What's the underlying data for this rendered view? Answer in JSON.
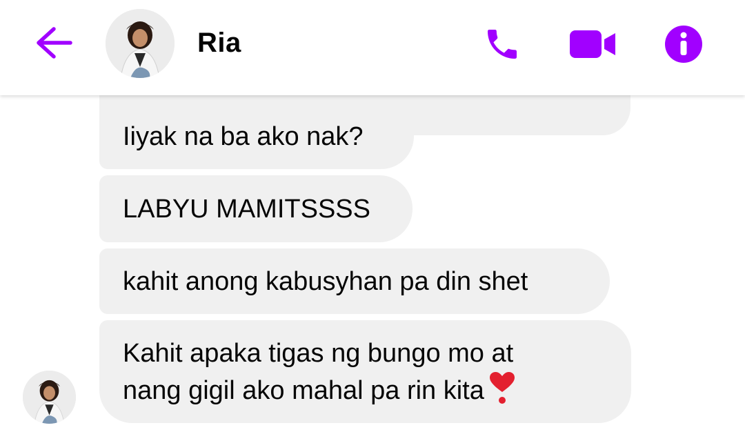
{
  "header": {
    "contact_name": "Ria",
    "icons": {
      "back": "back-arrow-icon",
      "phone": "phone-icon",
      "video": "video-camera-icon",
      "info": "info-icon"
    },
    "accent_color": "#a100ff"
  },
  "messages": [
    {
      "text": "Iiyak na ba ako nak?"
    },
    {
      "text": "LABYU MAMITSSSS"
    },
    {
      "text": "kahit anong kabusyhan pa din shet"
    },
    {
      "text": "Kahit apaka tigas ng bungo mo at\nnang gigil ako mahal pa rin kita",
      "emoji": "heart-exclamation-icon"
    }
  ]
}
